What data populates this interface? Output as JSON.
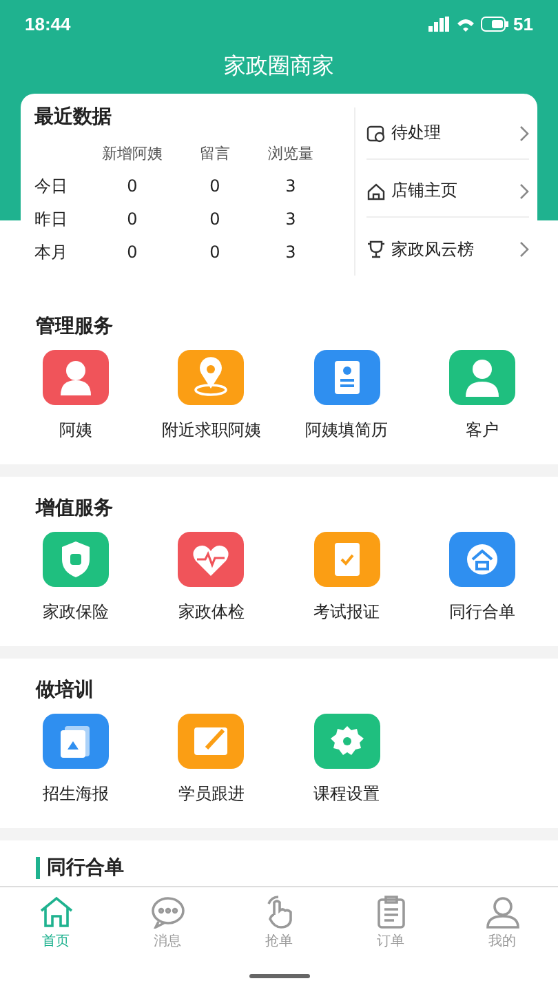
{
  "status_bar": {
    "time": "18:44",
    "battery": "51"
  },
  "header": {
    "title": "家政圈商家"
  },
  "recent_data": {
    "title": "最近数据",
    "columns": [
      "新增阿姨",
      "留言",
      "浏览量"
    ],
    "rows": [
      {
        "label": "今日",
        "values": [
          "0",
          "0",
          "3"
        ]
      },
      {
        "label": "昨日",
        "values": [
          "0",
          "0",
          "3"
        ]
      },
      {
        "label": "本月",
        "values": [
          "0",
          "0",
          "3"
        ]
      }
    ]
  },
  "quick_links": [
    {
      "label": "待处理"
    },
    {
      "label": "店铺主页"
    },
    {
      "label": "家政风云榜"
    }
  ],
  "sections": [
    {
      "title": "管理服务",
      "items": [
        {
          "label": "阿姨",
          "color": "#f0545a"
        },
        {
          "label": "附近求职阿姨",
          "color": "#fb9e14"
        },
        {
          "label": "阿姨填简历",
          "color": "#2f8ff0"
        },
        {
          "label": "客户",
          "color": "#1fbf7f"
        }
      ]
    },
    {
      "title": "增值服务",
      "items": [
        {
          "label": "家政保险",
          "color": "#1fbf7f"
        },
        {
          "label": "家政体检",
          "color": "#f0545a"
        },
        {
          "label": "考试报证",
          "color": "#fb9e14"
        },
        {
          "label": "同行合单",
          "color": "#2f8ff0"
        }
      ]
    },
    {
      "title": "做培训",
      "items": [
        {
          "label": "招生海报",
          "color": "#2f8ff0"
        },
        {
          "label": "学员跟进",
          "color": "#fb9e14"
        },
        {
          "label": "课程设置",
          "color": "#1fbf7f"
        }
      ]
    }
  ],
  "next_section": {
    "title": "同行合单"
  },
  "tab_bar": [
    {
      "label": "首页",
      "selected": true
    },
    {
      "label": "消息",
      "selected": false
    },
    {
      "label": "抢单",
      "selected": false
    },
    {
      "label": "订单",
      "selected": false
    },
    {
      "label": "我的",
      "selected": false
    }
  ]
}
